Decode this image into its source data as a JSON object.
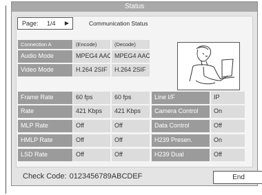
{
  "window": {
    "title": "Status"
  },
  "pager": {
    "label": "Page:",
    "value": "1/4",
    "arrow": "▶"
  },
  "section_title": "Communication Status",
  "left_table": {
    "header": {
      "label": "Connection A",
      "encode": "(Encode)",
      "decode": "(Decode)"
    },
    "rows": [
      {
        "label": "Audio Mode",
        "encode": "MPEG4 AAC",
        "decode": "MPEG4 AAC"
      },
      {
        "label": "Video Mode",
        "encode": "H.264 2SIF",
        "decode": "H.264 2SIF"
      },
      {
        "label": "Frame Rate",
        "encode": "60 fps",
        "decode": "60 fps"
      },
      {
        "label": "Rate",
        "encode": "421 Kbps",
        "decode": "421 Kbps"
      },
      {
        "label": "MLP Rate",
        "encode": "Off",
        "decode": "Off"
      },
      {
        "label": "HMLP Rate",
        "encode": "Off",
        "decode": "Off"
      },
      {
        "label": "LSD Rate",
        "encode": "Off",
        "decode": "Off"
      }
    ]
  },
  "right_table": {
    "rows": [
      {
        "label": "Line I/F",
        "value": "IP"
      },
      {
        "label": "Camera Control",
        "value": "On"
      },
      {
        "label": "Data Control",
        "value": "Off"
      },
      {
        "label": "H239 Presen.",
        "value": "On"
      },
      {
        "label": "H239 Dual",
        "value": "Off"
      }
    ]
  },
  "footer": {
    "check_code_label": "Check Code:",
    "check_code_value": "0123456789ABCDEF",
    "end_label": "End"
  },
  "colors": {
    "title_bar": "#a9a9a9",
    "label_cell": "#9b9b9b",
    "value_cell": "#dcdcdc",
    "panel": "#e4e4e4"
  }
}
